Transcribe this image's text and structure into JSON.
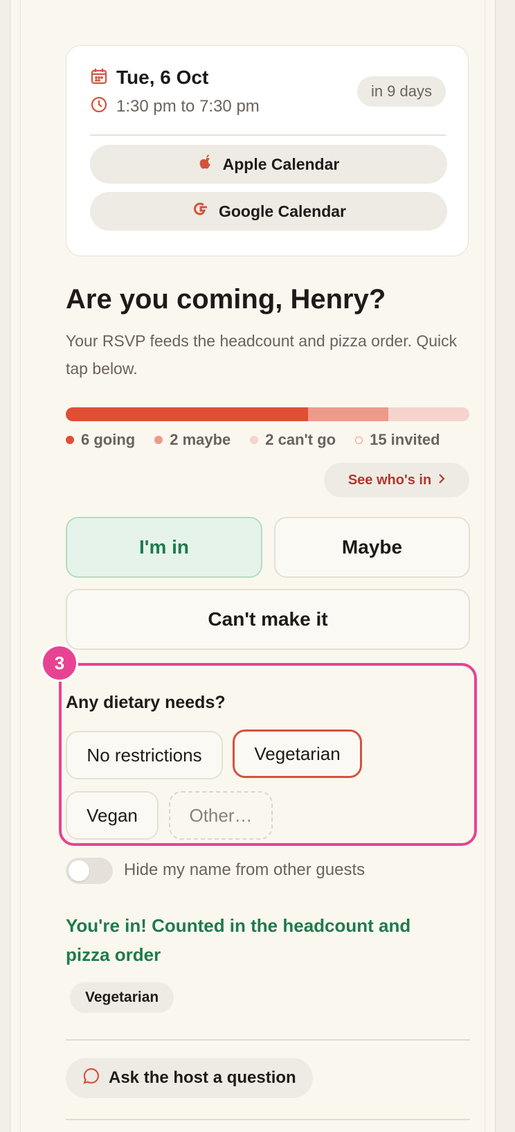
{
  "event": {
    "date": "Tue, 6 Oct",
    "time": "1:30 pm to 7:30 pm",
    "countdown": "in 9 days"
  },
  "calendar": {
    "apple_label": "Apple Calendar",
    "google_label": "Google Calendar"
  },
  "rsvp": {
    "heading": "Are you coming, Henry?",
    "subtext": "Your RSVP feeds the headcount and pizza order. Quick tap below.",
    "stats": {
      "going": 6,
      "maybe": 2,
      "cant_go": 2,
      "invited": 15
    },
    "legend": {
      "going": "6 going",
      "maybe": "2 maybe",
      "cant_go": "2 can't go",
      "invited": "15 invited"
    },
    "see_whos_in": "See who's in",
    "options": {
      "in": "I'm in",
      "maybe": "Maybe",
      "cant": "Can't make it"
    },
    "selected": "in"
  },
  "annotation": {
    "badge": "3"
  },
  "dietary": {
    "label": "Any dietary needs?",
    "options": [
      "No restrictions",
      "Vegetarian",
      "Vegan",
      "Other…"
    ],
    "selected": "Vegetarian"
  },
  "privacy": {
    "toggle_label": "Hide my name from other guests",
    "enabled": false
  },
  "confirmation": {
    "message": "You're in! Counted in the headcount and pizza order",
    "tag": "Vegetarian"
  },
  "host": {
    "ask_label": "Ask the host a question"
  },
  "colors": {
    "accent": "#d4533b",
    "going": "#e04e36",
    "maybe": "#ee9a8a",
    "cant_go": "#f4d4cc",
    "success": "#1f7a4d",
    "highlight": "#e84393"
  }
}
